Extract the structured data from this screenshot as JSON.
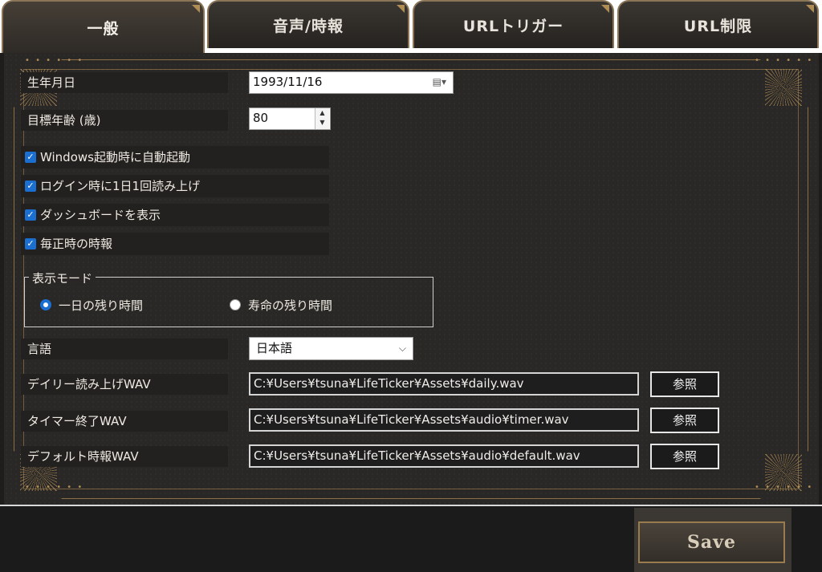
{
  "tabs": [
    {
      "label": "一般",
      "active": true
    },
    {
      "label": "音声/時報",
      "active": false
    },
    {
      "label": "URLトリガー",
      "active": false
    },
    {
      "label": "URL制限",
      "active": false
    }
  ],
  "general": {
    "birthday_label": "生年月日",
    "birthday_value": "1993/11/16",
    "target_age_label": "目標年齢 (歳)",
    "target_age_value": "80",
    "checkboxes": [
      {
        "label": "Windows起動時に自動起動",
        "checked": true
      },
      {
        "label": "ログイン時に1日1回読み上げ",
        "checked": true
      },
      {
        "label": "ダッシュボードを表示",
        "checked": true
      },
      {
        "label": "毎正時の時報",
        "checked": true
      }
    ],
    "display_mode": {
      "title": "表示モード",
      "options": [
        {
          "label": "一日の残り時間",
          "selected": true
        },
        {
          "label": "寿命の残り時間",
          "selected": false
        }
      ]
    },
    "language_label": "言語",
    "language_value": "日本語",
    "files": [
      {
        "label": "デイリー読み上げWAV",
        "path": "C:¥Users¥tsuna¥LifeTicker¥Assets¥daily.wav",
        "button": "参照"
      },
      {
        "label": "タイマー終了WAV",
        "path": "C:¥Users¥tsuna¥LifeTicker¥Assets¥audio¥timer.wav",
        "button": "参照"
      },
      {
        "label": "デフォルト時報WAV",
        "path": "C:¥Users¥tsuna¥LifeTicker¥Assets¥audio¥default.wav",
        "button": "参照"
      }
    ]
  },
  "footer": {
    "save_label": "Save"
  },
  "icons": {
    "date_picker": "calendar-dropdown-icon",
    "spin": "up-down-arrow-icon",
    "select": "chevron-down-icon"
  },
  "colors": {
    "accent_gold": "#b08d55",
    "check_blue": "#1b6fd1",
    "panel_bg": "#2a2826"
  }
}
